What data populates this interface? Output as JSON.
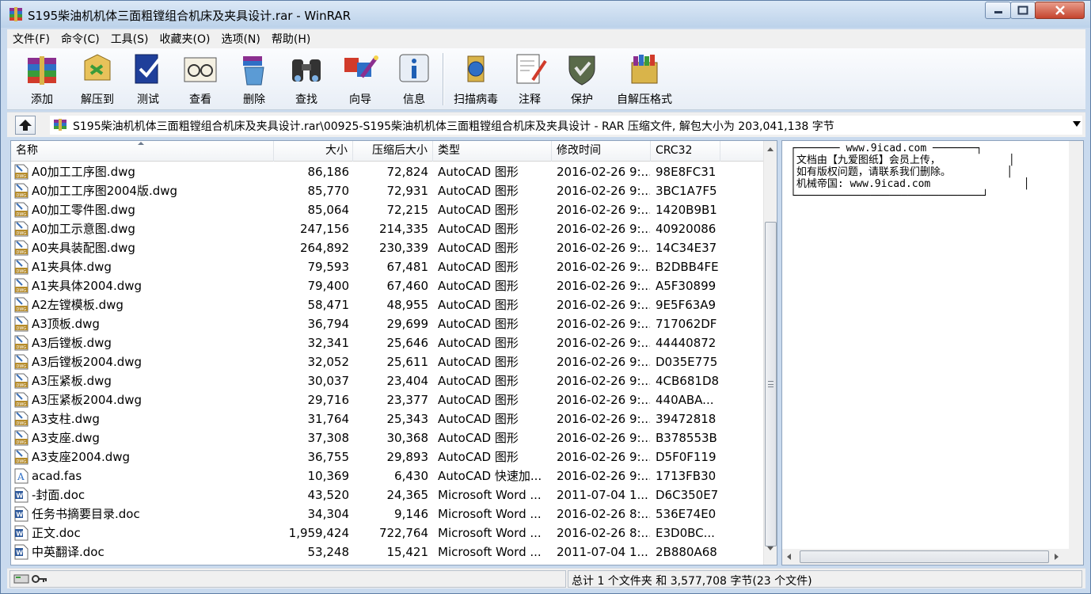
{
  "window": {
    "title": "S195柴油机机体三面粗镗组合机床及夹具设计.rar - WinRAR"
  },
  "menu": [
    "文件(F)",
    "命令(C)",
    "工具(S)",
    "收藏夹(O)",
    "选项(N)",
    "帮助(H)"
  ],
  "toolbar": [
    {
      "label": "添加",
      "icon": "add-books-icon"
    },
    {
      "label": "解压到",
      "icon": "extract-to-icon"
    },
    {
      "label": "测试",
      "icon": "test-icon"
    },
    {
      "label": "查看",
      "icon": "view-icon"
    },
    {
      "label": "删除",
      "icon": "delete-icon"
    },
    {
      "label": "查找",
      "icon": "find-binoculars-icon"
    },
    {
      "label": "向导",
      "icon": "wizard-icon"
    },
    {
      "label": "信息",
      "icon": "info-icon"
    },
    {
      "label": "扫描病毒",
      "icon": "virus-scan-icon"
    },
    {
      "label": "注释",
      "icon": "comment-icon"
    },
    {
      "label": "保护",
      "icon": "protect-shield-icon"
    },
    {
      "label": "自解压格式",
      "icon": "sfx-icon"
    }
  ],
  "path": "S195柴油机机体三面粗镗组合机床及夹具设计.rar\\00925-S195柴油机机体三面粗镗组合机床及夹具设计 - RAR 压缩文件, 解包大小为 203,041,138 字节",
  "columns": {
    "name": "名称",
    "size": "大小",
    "packed": "压缩后大小",
    "type": "类型",
    "modified": "修改时间",
    "crc": "CRC32"
  },
  "files": [
    {
      "name": "A0加工工序图.dwg",
      "size": "86,186",
      "packed": "72,824",
      "type": "AutoCAD 图形",
      "modified": "2016-02-26 9:...",
      "crc": "98E8FC31",
      "kind": "dwg"
    },
    {
      "name": "A0加工工序图2004版.dwg",
      "size": "85,770",
      "packed": "72,931",
      "type": "AutoCAD 图形",
      "modified": "2016-02-26 9:...",
      "crc": "3BC1A7F5",
      "kind": "dwg"
    },
    {
      "name": "A0加工零件图.dwg",
      "size": "85,064",
      "packed": "72,215",
      "type": "AutoCAD 图形",
      "modified": "2016-02-26 9:...",
      "crc": "1420B9B1",
      "kind": "dwg"
    },
    {
      "name": "A0加工示意图.dwg",
      "size": "247,156",
      "packed": "214,335",
      "type": "AutoCAD 图形",
      "modified": "2016-02-26 9:...",
      "crc": "40920086",
      "kind": "dwg"
    },
    {
      "name": "A0夹具装配图.dwg",
      "size": "264,892",
      "packed": "230,339",
      "type": "AutoCAD 图形",
      "modified": "2016-02-26 9:...",
      "crc": "14C34E37",
      "kind": "dwg"
    },
    {
      "name": "A1夹具体.dwg",
      "size": "79,593",
      "packed": "67,481",
      "type": "AutoCAD 图形",
      "modified": "2016-02-26 9:...",
      "crc": "B2DBB4FE",
      "kind": "dwg"
    },
    {
      "name": "A1夹具体2004.dwg",
      "size": "79,400",
      "packed": "67,460",
      "type": "AutoCAD 图形",
      "modified": "2016-02-26 9:...",
      "crc": "A5F30899",
      "kind": "dwg"
    },
    {
      "name": "A2左镗模板.dwg",
      "size": "58,471",
      "packed": "48,955",
      "type": "AutoCAD 图形",
      "modified": "2016-02-26 9:...",
      "crc": "9E5F63A9",
      "kind": "dwg"
    },
    {
      "name": "A3顶板.dwg",
      "size": "36,794",
      "packed": "29,699",
      "type": "AutoCAD 图形",
      "modified": "2016-02-26 9:...",
      "crc": "717062DF",
      "kind": "dwg"
    },
    {
      "name": "A3后镗板.dwg",
      "size": "32,341",
      "packed": "25,646",
      "type": "AutoCAD 图形",
      "modified": "2016-02-26 9:...",
      "crc": "44440872",
      "kind": "dwg"
    },
    {
      "name": "A3后镗板2004.dwg",
      "size": "32,052",
      "packed": "25,611",
      "type": "AutoCAD 图形",
      "modified": "2016-02-26 9:...",
      "crc": "D035E775",
      "kind": "dwg"
    },
    {
      "name": "A3压紧板.dwg",
      "size": "30,037",
      "packed": "23,404",
      "type": "AutoCAD 图形",
      "modified": "2016-02-26 9:...",
      "crc": "4CB681D8",
      "kind": "dwg"
    },
    {
      "name": "A3压紧板2004.dwg",
      "size": "29,716",
      "packed": "23,377",
      "type": "AutoCAD 图形",
      "modified": "2016-02-26 9:...",
      "crc": "440ABA...",
      "kind": "dwg"
    },
    {
      "name": "A3支柱.dwg",
      "size": "31,764",
      "packed": "25,343",
      "type": "AutoCAD 图形",
      "modified": "2016-02-26 9:...",
      "crc": "39472818",
      "kind": "dwg"
    },
    {
      "name": "A3支座.dwg",
      "size": "37,308",
      "packed": "30,368",
      "type": "AutoCAD 图形",
      "modified": "2016-02-26 9:...",
      "crc": "B378553B",
      "kind": "dwg"
    },
    {
      "name": "A3支座2004.dwg",
      "size": "36,755",
      "packed": "29,893",
      "type": "AutoCAD 图形",
      "modified": "2016-02-26 9:...",
      "crc": "D5F0F119",
      "kind": "dwg"
    },
    {
      "name": "acad.fas",
      "size": "10,369",
      "packed": "6,430",
      "type": "AutoCAD 快速加...",
      "modified": "2016-02-26 9:...",
      "crc": "1713FB30",
      "kind": "fas"
    },
    {
      "name": "-封面.doc",
      "size": "43,520",
      "packed": "24,365",
      "type": "Microsoft Word ...",
      "modified": "2011-07-04 1...",
      "crc": "D6C350E7",
      "kind": "doc"
    },
    {
      "name": "任务书摘要目录.doc",
      "size": "34,304",
      "packed": "9,146",
      "type": "Microsoft Word ...",
      "modified": "2016-02-26 8:...",
      "crc": "536E74E0",
      "kind": "doc"
    },
    {
      "name": "正文.doc",
      "size": "1,959,424",
      "packed": "722,764",
      "type": "Microsoft Word ...",
      "modified": "2016-02-26 8:...",
      "crc": "E3D0BC...",
      "kind": "doc"
    },
    {
      "name": "中英翻译.doc",
      "size": "53,248",
      "packed": "15,421",
      "type": "Microsoft Word ...",
      "modified": "2011-07-04 1...",
      "crc": "2B880A68",
      "kind": "doc"
    }
  ],
  "comment": "┌─────── www.9icad.com ───────┐\n│文档由【九爱图纸】会员上传，           │\n│如有版权问题，请联系我们删除。         │\n│机械帝国: www.9icad.com               │\n└──────────────────────────────┘",
  "status": {
    "summary": "总计 1 个文件夹 和 3,577,708 字节(23 个文件)"
  },
  "colors": {
    "window_frame": "#c9daee",
    "title_close": "#c5442e",
    "selection": "#cce8ff"
  }
}
